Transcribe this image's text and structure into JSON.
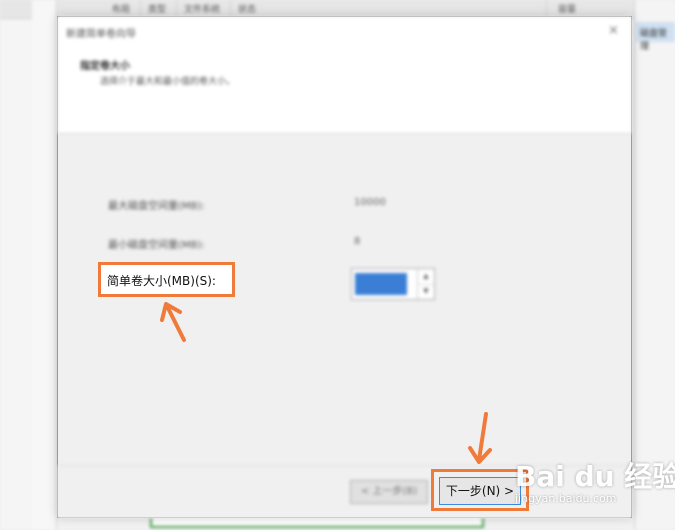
{
  "background": {
    "columns": [
      "布局",
      "类型",
      "文件系统",
      "状态",
      "容量",
      "操作"
    ],
    "right_panel": [
      "磁盘管理"
    ]
  },
  "dialog": {
    "title": "新建简单卷向导",
    "close_glyph": "×",
    "header": {
      "heading": "指定卷大小",
      "subtitle": "选择介于最大和最小值的卷大小。"
    },
    "fields": [
      {
        "label": "最大磁盘空间量(MB):",
        "value": "10000"
      },
      {
        "label": "最小磁盘空间量(MB):",
        "value": "8"
      }
    ],
    "size_field": {
      "label": "简单卷大小(MB)(S):",
      "spin_up": "▲",
      "spin_down": "▼"
    },
    "buttons": {
      "back": "< 上一步(B)",
      "next": "下一步(N) >"
    }
  },
  "watermark": {
    "brand": "Bai du 经验",
    "url": "jingyan.baidu.com"
  },
  "colors": {
    "highlight": "#f07a3a",
    "selection": "#3a7fd5",
    "focus_border": "#3c8ce0"
  }
}
